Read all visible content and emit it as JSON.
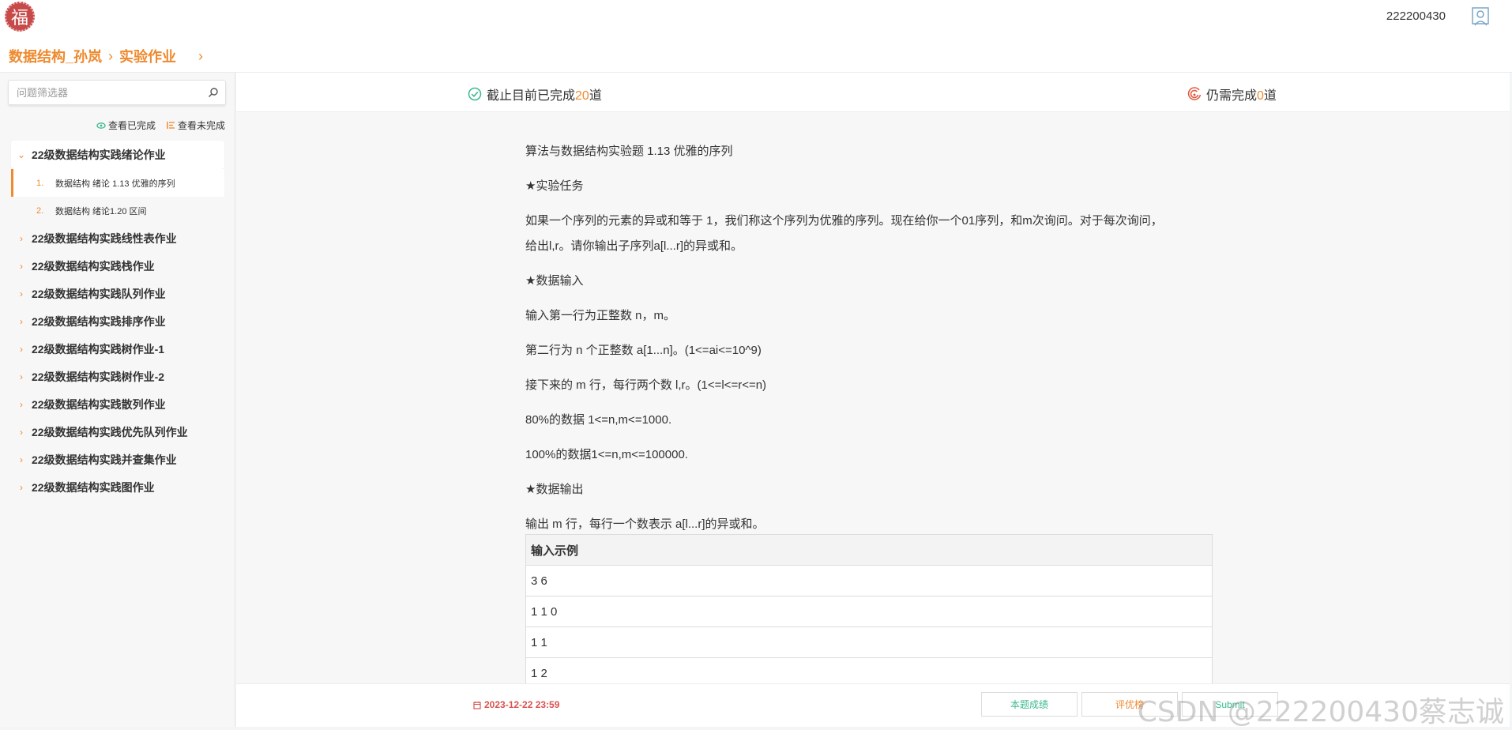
{
  "header": {
    "logo_char": "福",
    "user_id": "222200430",
    "breadcrumb": [
      "数据结构_孙岚",
      "实验作业"
    ]
  },
  "sidebar": {
    "search_placeholder": "问题筛选器",
    "filter_done": "查看已完成",
    "filter_undone": "查看未完成",
    "groups": [
      {
        "label": "22级数据结构实践绪论作业",
        "open": true,
        "items": [
          {
            "num": "1.",
            "label": "数据结构 绪论 1.13 优雅的序列"
          },
          {
            "num": "2.",
            "label": "数据结构 绪论1.20 区间"
          }
        ]
      },
      {
        "label": "22级数据结构实践线性表作业"
      },
      {
        "label": "22级数据结构实践栈作业"
      },
      {
        "label": "22级数据结构实践队列作业"
      },
      {
        "label": "22级数据结构实践排序作业"
      },
      {
        "label": "22级数据结构实践树作业-1"
      },
      {
        "label": "22级数据结构实践树作业-2"
      },
      {
        "label": "22级数据结构实践散列作业"
      },
      {
        "label": "22级数据结构实践优先队列作业"
      },
      {
        "label": "22级数据结构实践并查集作业"
      },
      {
        "label": "22级数据结构实践图作业"
      }
    ]
  },
  "status": {
    "done_prefix": "截止目前已完成",
    "done_count": "20",
    "done_suffix": "道",
    "todo_prefix": "仍需完成",
    "todo_count": "0",
    "todo_suffix": "道"
  },
  "problem": {
    "title": "算法与数据结构实验题 1.13 优雅的序列",
    "task_heading": "★实验任务",
    "task_line1": "如果一个序列的元素的异或和等于 1，我们称这个序列为优雅的序列。现在给你一个01序列，和m次询问。对于每次询问，",
    "task_line2": "给出l,r。请你输出子序列a[l...r]的异或和。",
    "input_heading": "★数据输入",
    "input_line1": "输入第一行为正整数 n，m。",
    "input_line2": "第二行为 n 个正整数 a[1...n]。(1<=ai<=10^9)",
    "input_line3": "接下来的 m 行，每行两个数 l,r。(1<=l<=r<=n)",
    "input_line4": "80%的数据 1<=n,m<=1000.",
    "input_line5": "100%的数据1<=n,m<=100000.",
    "output_heading": "★数据输出",
    "output_line1": "输出 m 行，每行一个数表示 a[l...r]的异或和。",
    "sample_header": "输入示例",
    "sample_rows": [
      "3 6",
      "1 1 0",
      "1 1",
      "1 2"
    ]
  },
  "footer": {
    "deadline": "2023-12-22 23:59",
    "btn_score": "本题成绩",
    "btn_rank": "评优榜",
    "btn_submit": "Submit"
  },
  "watermark": "CSDN @222200430蔡志诚",
  "colors": {
    "accent": "#ee8a2f",
    "success": "#3bb98f",
    "danger": "#d9534f"
  }
}
